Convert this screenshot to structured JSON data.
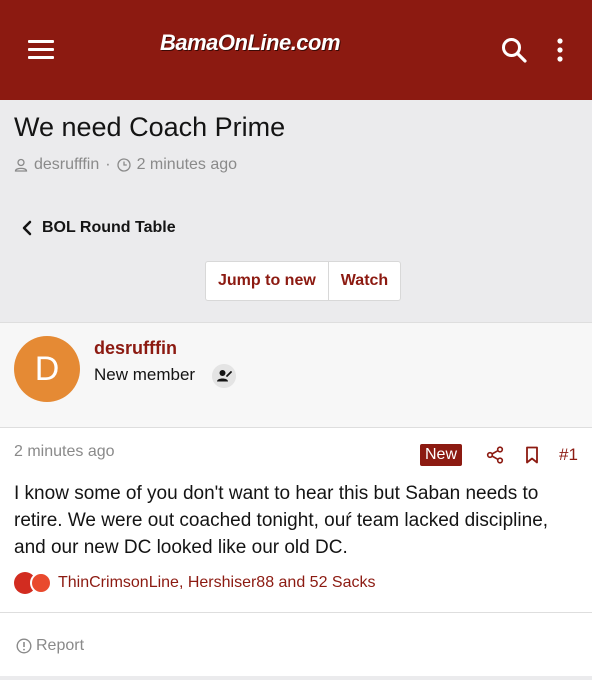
{
  "header": {
    "logo_text": "BamaOnLine.com",
    "menu_icon": "hamburger-menu-icon",
    "search_icon": "search-icon",
    "more_icon": "vertical-ellipsis-icon",
    "bar_color": "#8c1a11"
  },
  "thread": {
    "title": "We need Coach Prime",
    "author": "desrufffin",
    "separator": "·",
    "time": "2 minutes ago"
  },
  "breadcrumb": {
    "label": "BOL Round Table"
  },
  "actions": {
    "jump_to_new": "Jump to new",
    "watch": "Watch"
  },
  "post": {
    "avatar_letter": "D",
    "avatar_color": "#e58a34",
    "username": "desrufffin",
    "user_title": "New member",
    "time": "2 minutes ago",
    "new_badge": "New",
    "number": "#1",
    "body": "I know some of you don't want to hear this but Saban needs to retire. We were out coached tonight, ouŕ team lacked discipline, and our new DC looked like our old DC.",
    "reactions_text": "ThinCrimsonLine, Hershiser88 and 52 Sacks",
    "report_label": "Report"
  },
  "colors": {
    "accent": "#8c1a11",
    "page_bg": "#ebebed",
    "muted_text": "#8a8a8a"
  }
}
